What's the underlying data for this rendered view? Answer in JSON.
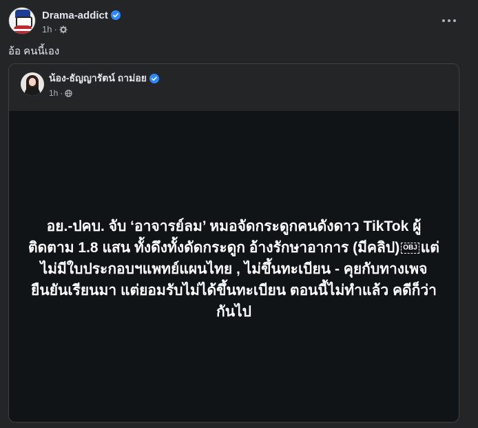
{
  "post": {
    "author": "Drama-addict",
    "time": "1h",
    "separator": "·",
    "audience_icon": "gear-icon",
    "text": "อ้อ คนนี้เอง",
    "more_icon": "more-horizontal-icon"
  },
  "shared_post": {
    "author": "น้อง-ธัญญารัตน์ ถาม่อย",
    "time": "1h",
    "separator": "·",
    "audience_icon": "globe-icon",
    "headline_part1": "อย.-ปคบ. จับ ‘อาจารย์ลม’ หมอจัดกระดูกคนดังดาว TikTok ผู้ติดตาม 1.8 แสน ทั้งดึงทั้งดัดกระดูก อ้างรักษาอาการ (มีคลิป)",
    "headline_obj": "OBJ",
    "headline_part2": "แต่ไม่มีใบประกอบฯแพทย์แผนไทย , ไม่ขึ้นทะเบียน - คุยกับทางเพจยืนยันเรียนมา แต่ยอมรับไม่ได้ขึ้นทะเบียน ตอนนี้ไม่ทำแล้ว คดีก็ว่ากันไป"
  },
  "colors": {
    "background": "#242526",
    "verified": "#2d88ff",
    "image_background": "#101417"
  }
}
